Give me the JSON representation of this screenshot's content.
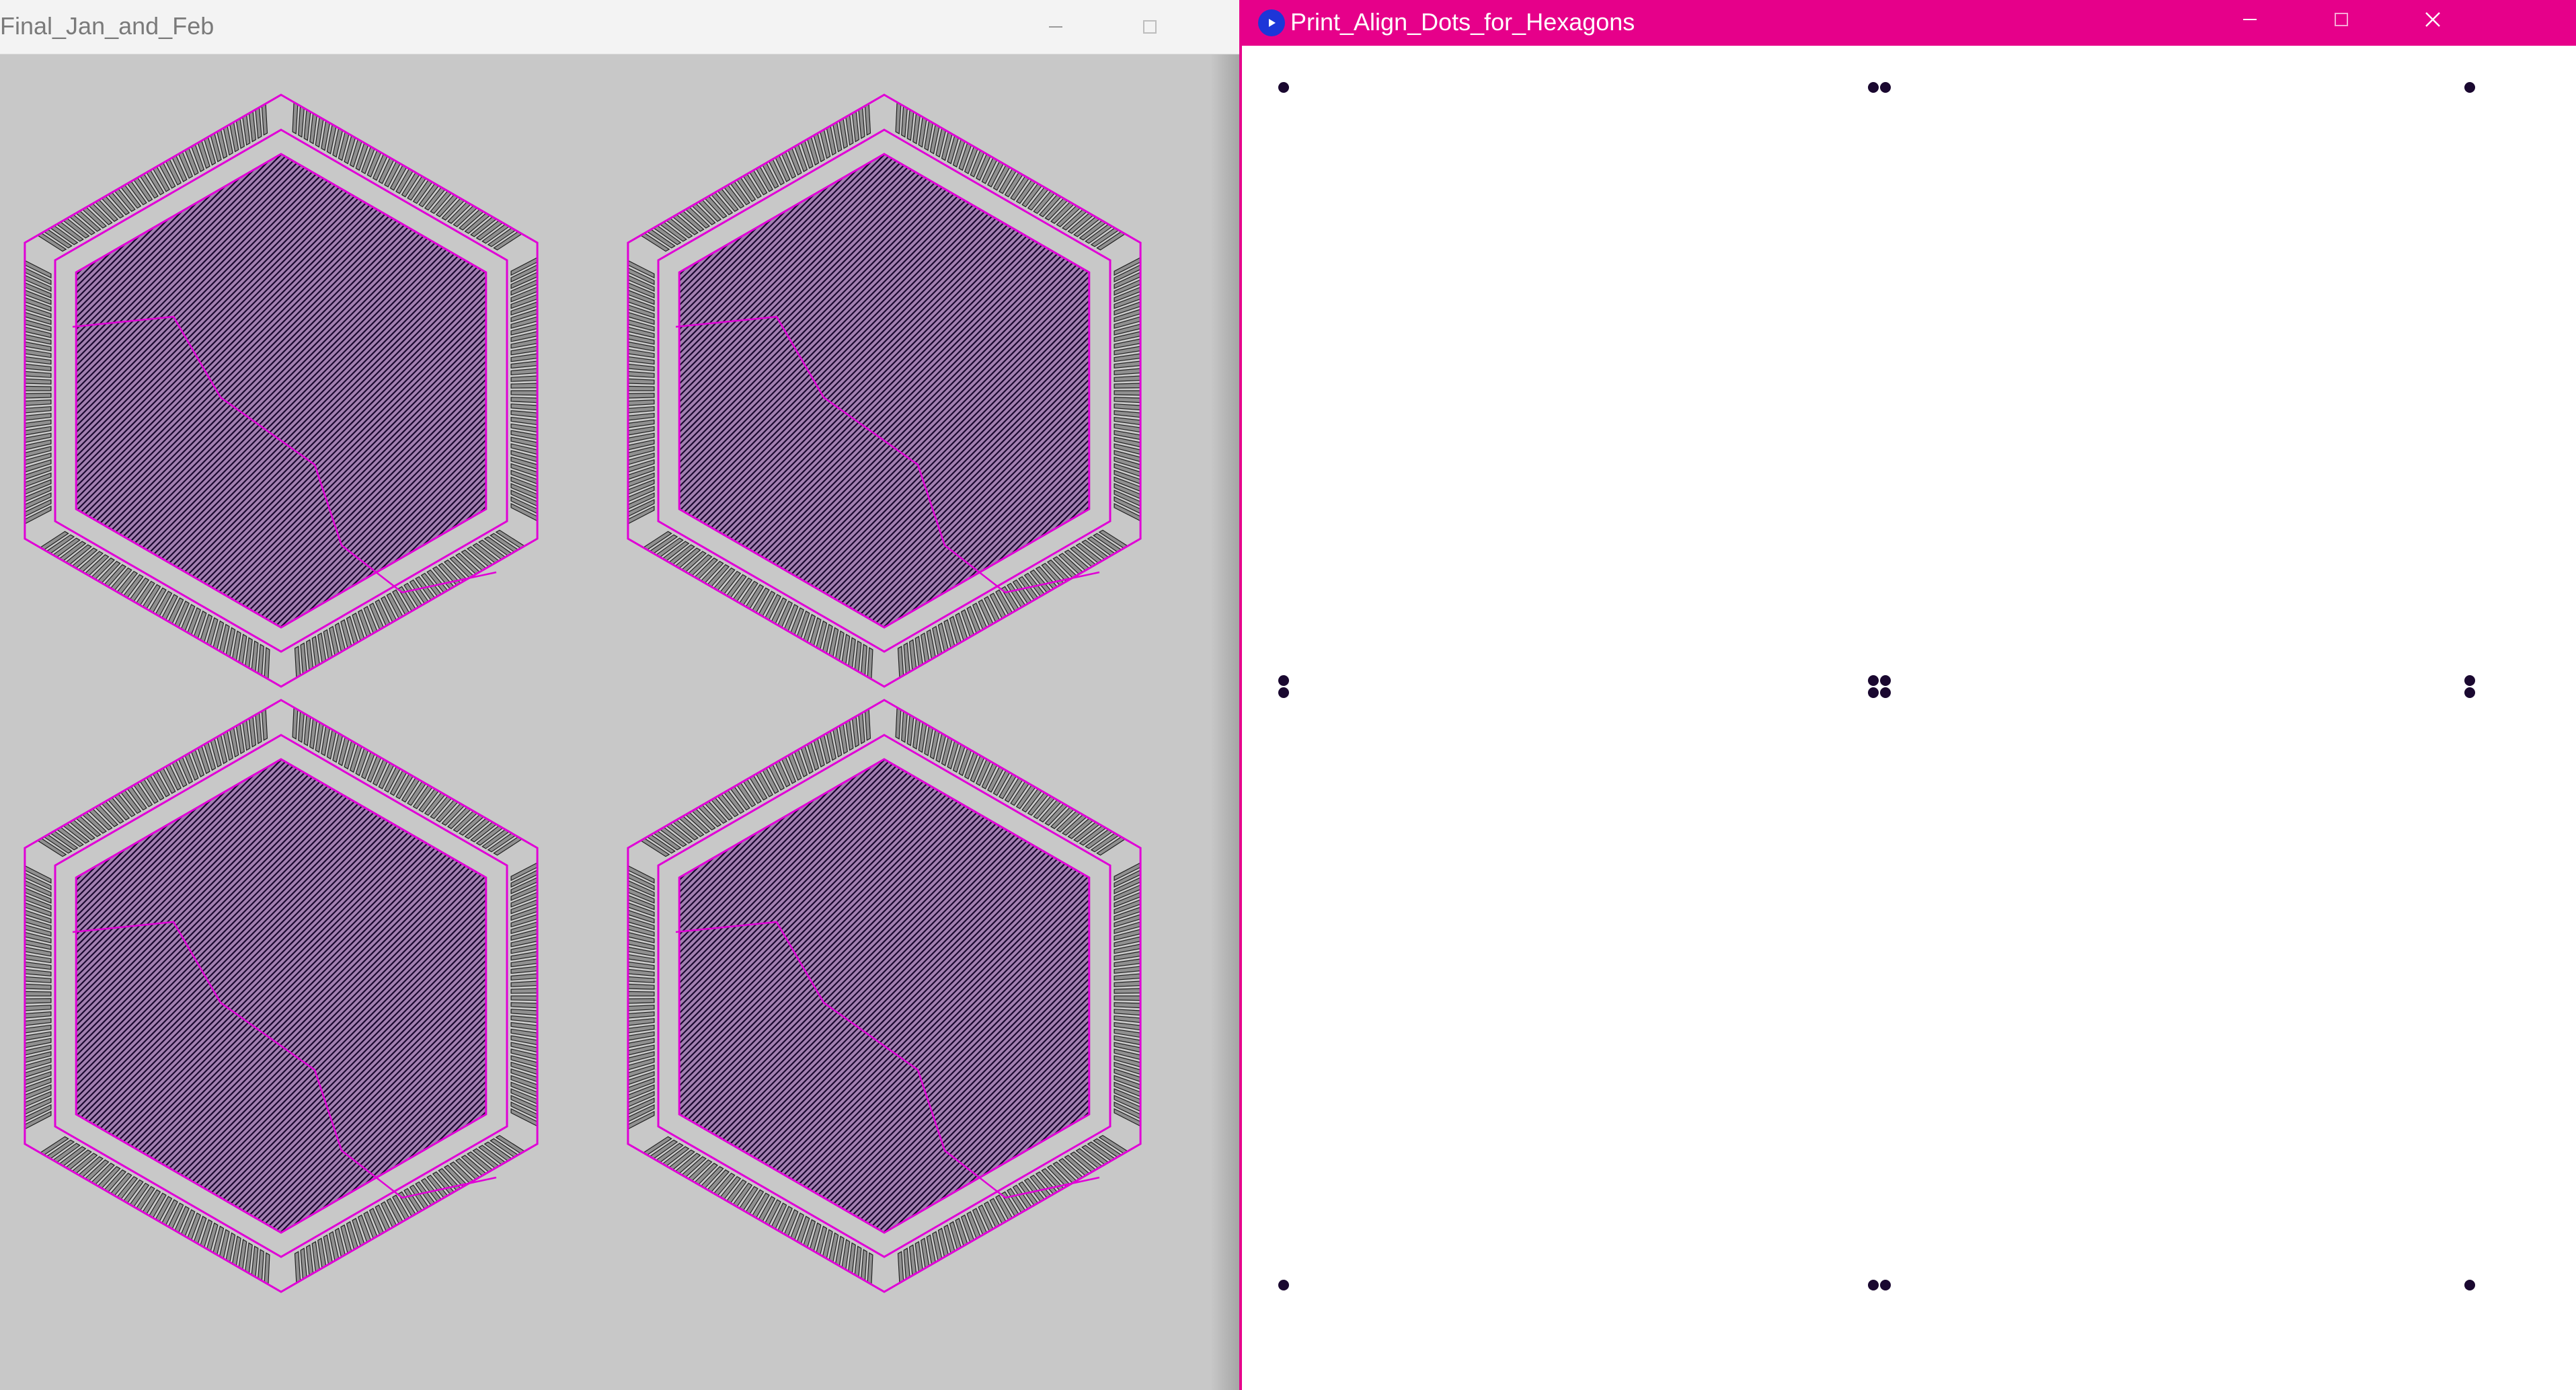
{
  "left_window": {
    "title": "Final_Jan_and_Feb",
    "controls": {
      "minimize": "minimize-icon",
      "maximize": "maximize-icon",
      "close": "close-icon"
    },
    "canvas": {
      "background": "#c8c8c8",
      "hexagon_count": 4,
      "outline_color": "#e000d6",
      "hatch_color": "#1a0830",
      "tooth_fill": "#909090"
    }
  },
  "right_window": {
    "title": "Print_Align_Dots_for_Hexagons",
    "app_icon": "processing-play-icon",
    "controls": {
      "minimize": "minimize-icon",
      "maximize": "maximize-icon",
      "close": "close-icon"
    },
    "accent_color": "#e6008a",
    "canvas": {
      "background": "#ffffff",
      "dot_color": "#1a0830",
      "dot_groups": [
        {
          "row": "top",
          "col": "left",
          "dots": 1
        },
        {
          "row": "top",
          "col": "center",
          "dots": 2
        },
        {
          "row": "top",
          "col": "right",
          "dots": 1
        },
        {
          "row": "middle",
          "col": "left",
          "dots": 2
        },
        {
          "row": "middle",
          "col": "center",
          "dots": 4
        },
        {
          "row": "middle",
          "col": "right",
          "dots": 2
        },
        {
          "row": "bottom",
          "col": "left",
          "dots": 1
        },
        {
          "row": "bottom",
          "col": "center",
          "dots": 2
        },
        {
          "row": "bottom",
          "col": "right",
          "dots": 1
        }
      ]
    }
  }
}
